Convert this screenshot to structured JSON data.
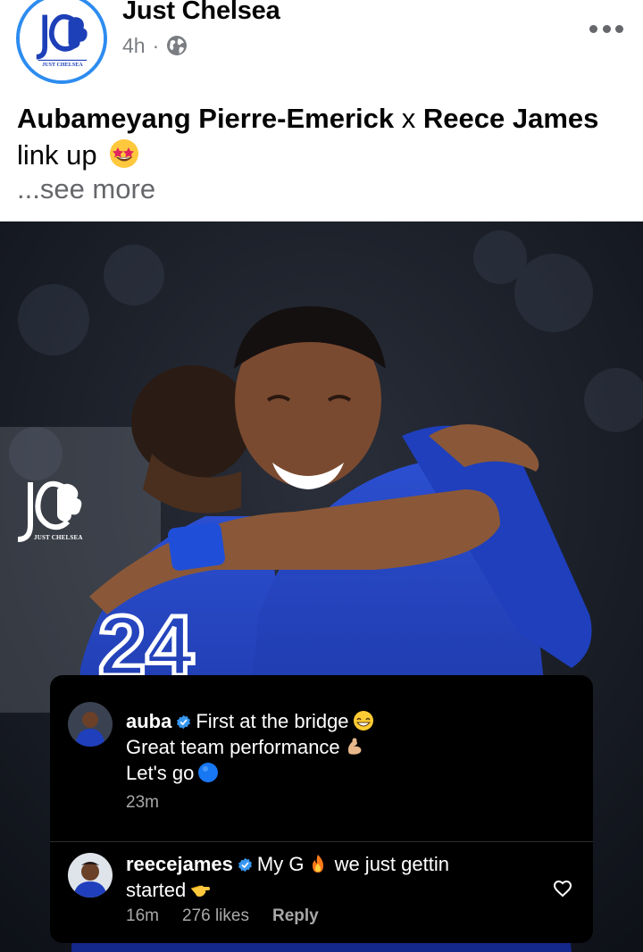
{
  "post": {
    "page_name": "Just Chelsea",
    "time": "4h",
    "separator": "·",
    "avatar_monogram": "JC",
    "avatar_caption": "JUST CHELSEA",
    "icons": {
      "privacy": "globe-icon",
      "more": "more-horizontal-icon"
    }
  },
  "caption": {
    "name1": "Aubameyang Pierre-Emerick",
    "connector": " x ",
    "name2": "Reece James",
    "line2": "link up",
    "emoji": "star-struck-emoji",
    "see_more": "...see more"
  },
  "photo": {
    "watermark_text": "JUST CHELSEA",
    "comments": [
      {
        "username": "auba",
        "lines": [
          "First at the bridge",
          "Great team performance",
          "Let's go"
        ],
        "emojis": [
          "grinning-emoji",
          "flexed-arm-emoji",
          "blue-circle-emoji"
        ],
        "time": "23m"
      },
      {
        "username": "reecejames",
        "text_a": "My G",
        "text_b": " we just gettin",
        "text_c": "started",
        "emojis": [
          "fire-emoji",
          "pointing-hand-emoji"
        ],
        "time": "16m",
        "likes": "276 likes",
        "reply": "Reply"
      }
    ]
  },
  "colors": {
    "avatar_ring": "#2d8cf0",
    "chelsea_blue": "#1d3fb8",
    "verified_blue": "#3797f0",
    "meta_gray": "#65676b"
  }
}
